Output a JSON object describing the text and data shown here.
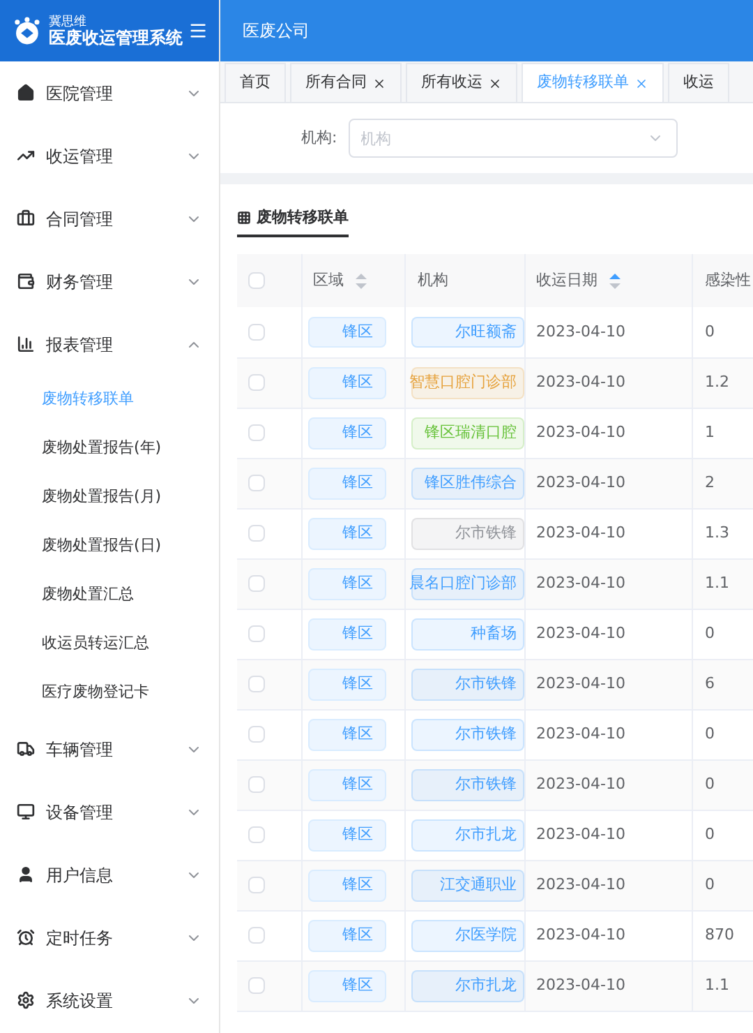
{
  "logo": {
    "subtitle": "冀思维",
    "title": "医废收运管理系统"
  },
  "header": {
    "title": "医废公司"
  },
  "sidebar": {
    "items": [
      {
        "label": "医院管理",
        "expanded": false
      },
      {
        "label": "收运管理",
        "expanded": false
      },
      {
        "label": "合同管理",
        "expanded": false
      },
      {
        "label": "财务管理",
        "expanded": false
      },
      {
        "label": "报表管理",
        "expanded": true,
        "children": [
          {
            "label": "废物转移联单",
            "selected": true
          },
          {
            "label": "废物处置报告(年)",
            "selected": false
          },
          {
            "label": "废物处置报告(月)",
            "selected": false
          },
          {
            "label": "废物处置报告(日)",
            "selected": false
          },
          {
            "label": "废物处置汇总",
            "selected": false
          },
          {
            "label": "收运员转运汇总",
            "selected": false
          },
          {
            "label": "医疗废物登记卡",
            "selected": false
          }
        ]
      },
      {
        "label": "车辆管理",
        "expanded": false
      },
      {
        "label": "设备管理",
        "expanded": false
      },
      {
        "label": "用户信息",
        "expanded": false
      },
      {
        "label": "定时任务",
        "expanded": false
      },
      {
        "label": "系统设置",
        "expanded": false
      }
    ]
  },
  "tabs": [
    {
      "label": "首页",
      "closable": false,
      "selected": false
    },
    {
      "label": "所有合同",
      "closable": true,
      "selected": false
    },
    {
      "label": "所有收运",
      "closable": true,
      "selected": false
    },
    {
      "label": "废物转移联单",
      "closable": true,
      "selected": true
    },
    {
      "label": "收运",
      "closable": false,
      "selected": false
    }
  ],
  "filter": {
    "label": "机构:",
    "placeholder": "机构"
  },
  "card": {
    "title": "废物转移联单"
  },
  "table": {
    "header_checked": false,
    "columns": [
      {
        "label": "区域",
        "sortable": true,
        "sorted": false
      },
      {
        "label": "机构",
        "sortable": false
      },
      {
        "label": "收运日期",
        "sortable": true,
        "sorted": true
      },
      {
        "label": "感染性",
        "sortable": false
      }
    ],
    "rows": [
      {
        "checked": false,
        "region": "锋区",
        "org": "尔旺额斋",
        "color": "#409eff",
        "date": "2023-04-10",
        "infectious": "0"
      },
      {
        "checked": false,
        "region": "锋区",
        "org": "智慧口腔门诊部",
        "color": "#e6a23c",
        "date": "2023-04-10",
        "infectious": "1.2"
      },
      {
        "checked": false,
        "region": "锋区",
        "org": "锋区瑞清口腔",
        "color": "#67c23a",
        "date": "2023-04-10",
        "infectious": "1"
      },
      {
        "checked": false,
        "region": "锋区",
        "org": "锋区胜伟综合",
        "color": "#409eff",
        "date": "2023-04-10",
        "infectious": "2"
      },
      {
        "checked": false,
        "region": "锋区",
        "org": "尔市铁锋",
        "color": "#909399",
        "date": "2023-04-10",
        "infectious": "1.3"
      },
      {
        "checked": false,
        "region": "锋区",
        "org": "晨名口腔门诊部",
        "color": "#409eff",
        "date": "2023-04-10",
        "infectious": "1.1"
      },
      {
        "checked": false,
        "region": "锋区",
        "org": "种畜场",
        "color": "#409eff",
        "date": "2023-04-10",
        "infectious": "0"
      },
      {
        "checked": false,
        "region": "锋区",
        "org": "尔市铁锋",
        "color": "#409eff",
        "date": "2023-04-10",
        "infectious": "6"
      },
      {
        "checked": false,
        "region": "锋区",
        "org": "尔市铁锋",
        "color": "#409eff",
        "date": "2023-04-10",
        "infectious": "0"
      },
      {
        "checked": false,
        "region": "锋区",
        "org": "尔市铁锋",
        "color": "#409eff",
        "date": "2023-04-10",
        "infectious": "0"
      },
      {
        "checked": false,
        "region": "锋区",
        "org": "尔市扎龙",
        "color": "#409eff",
        "date": "2023-04-10",
        "infectious": "0"
      },
      {
        "checked": false,
        "region": "锋区",
        "org": "江交通职业",
        "color": "#409eff",
        "date": "2023-04-10",
        "infectious": "0"
      },
      {
        "checked": false,
        "region": "锋区",
        "org": "尔医学院",
        "color": "#409eff",
        "date": "2023-04-10",
        "infectious": "870"
      },
      {
        "checked": false,
        "region": "锋区",
        "org": "尔市扎龙",
        "color": "#409eff",
        "date": "2023-04-10",
        "infectious": "1.1"
      }
    ]
  }
}
